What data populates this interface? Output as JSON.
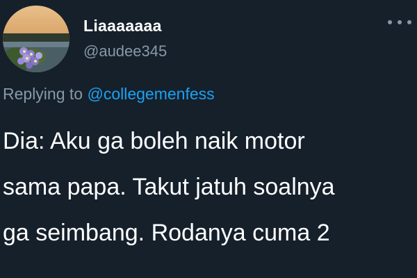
{
  "user": {
    "display_name": "Liaaaaaaa",
    "handle": "@audee345",
    "avatar_icon": "profile-photo"
  },
  "menu": {
    "icon": "more-options-icon"
  },
  "reply": {
    "prefix": "Replying to",
    "mention": "@collegemenfess"
  },
  "tweet": {
    "lines": [
      "Dia: Aku ga boleh naik motor",
      "sama papa. Takut jatuh soalnya",
      "ga seimbang. Rodanya cuma 2"
    ]
  },
  "colors": {
    "background": "#15202b",
    "text": "#ffffff",
    "secondary": "#8899a6",
    "link": "#1da1f2"
  }
}
